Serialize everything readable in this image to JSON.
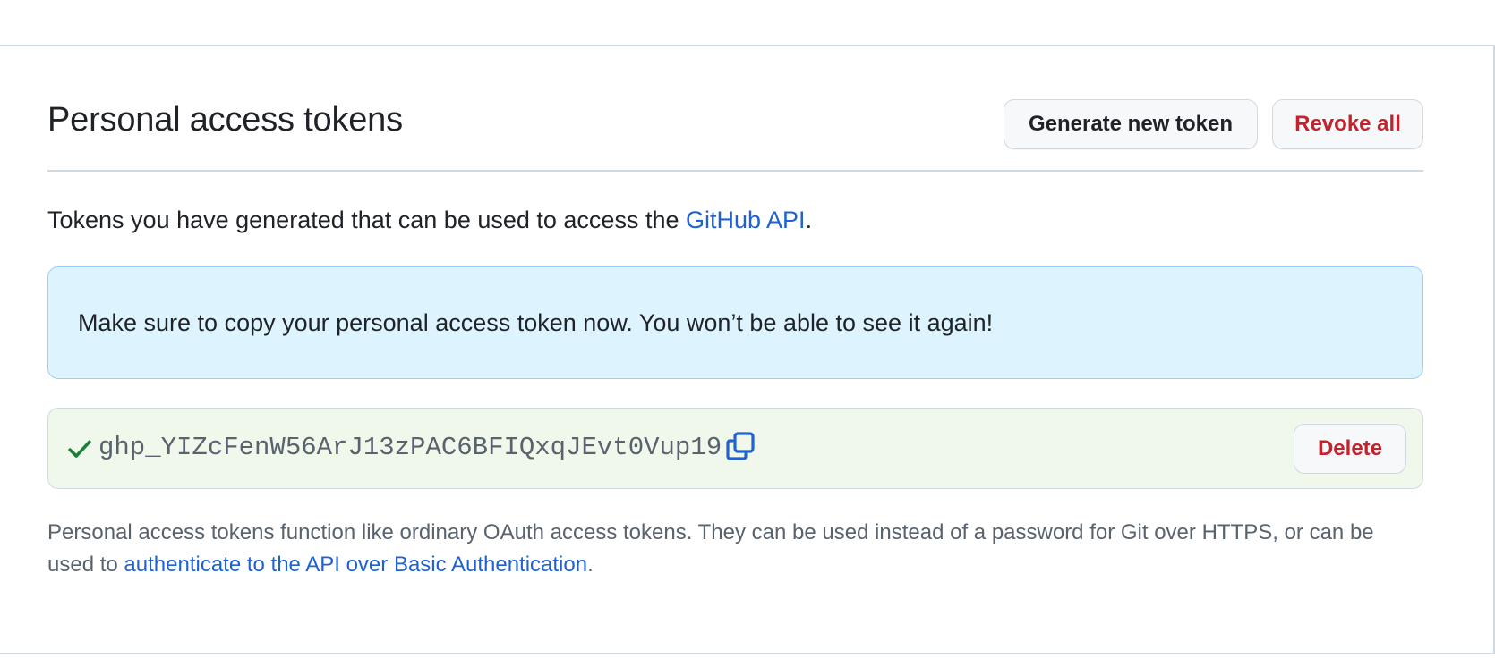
{
  "header": {
    "title": "Personal access tokens",
    "generate_label": "Generate new token",
    "revoke_label": "Revoke all"
  },
  "intro": {
    "text": "Tokens you have generated that can be used to access the ",
    "link": "GitHub API",
    "suffix": "."
  },
  "flash": {
    "message": "Make sure to copy your personal access token now. You won’t be able to see it again!"
  },
  "token": {
    "value": "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",
    "status_icon": "check-icon",
    "copy_icon": "copy-icon",
    "delete_label": "Delete"
  },
  "footnote": {
    "text": "Personal access tokens function like ordinary OAuth access tokens. They can be used instead of a password for Git over HTTPS, or can be used to ",
    "link": "authenticate to the API over Basic Authentication",
    "suffix": "."
  },
  "colors": {
    "link": "#1f62d0",
    "danger": "#c2232c",
    "info_bg": "#ddf4ff",
    "success_bg": "#f0f8ec",
    "success_icon": "#1a7f37"
  }
}
